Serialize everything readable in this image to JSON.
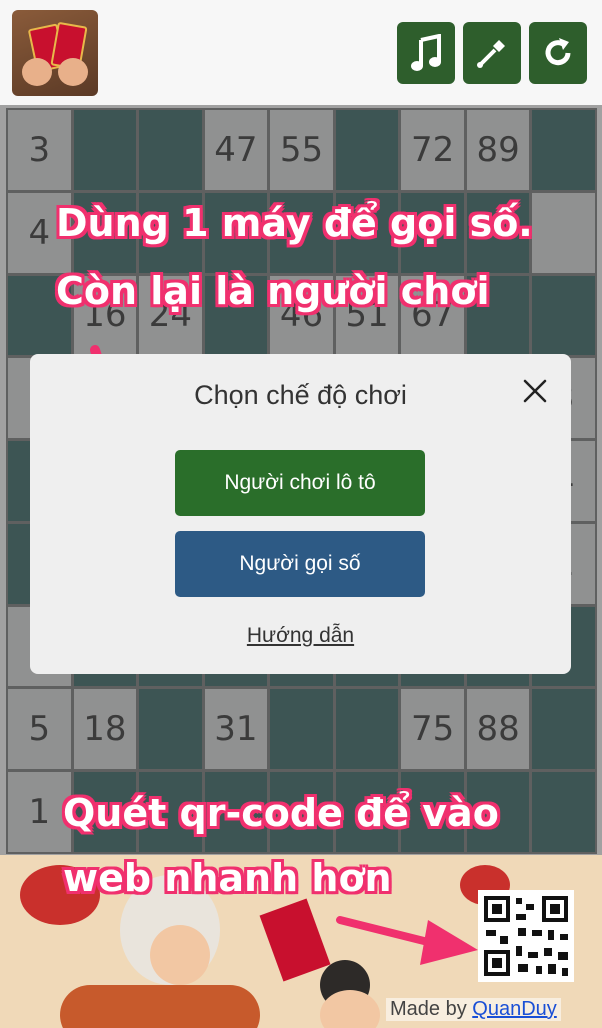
{
  "toolbar": {
    "music_icon": "music-note-icon",
    "picker_icon": "eyedropper-icon",
    "refresh_icon": "refresh-icon",
    "button_color": "#2e5e2c"
  },
  "board": {
    "rows": [
      [
        "3",
        "",
        "",
        "47",
        "55",
        "",
        "72",
        "89"
      ],
      [
        "4",
        "",
        "",
        "",
        "",
        "",
        "",
        "",
        ""
      ],
      [
        "",
        "16",
        "24",
        "",
        "46",
        "51",
        "67",
        "",
        "",
        ""
      ],
      [
        "",
        "",
        "",
        "",
        "",
        "",
        "",
        "",
        "3"
      ],
      [
        "",
        "",
        "",
        "",
        "",
        "",
        "",
        "",
        "4"
      ],
      [
        "",
        "",
        "",
        "",
        "",
        "",
        "",
        "",
        "1"
      ],
      [
        "",
        "",
        "",
        "",
        "",
        "",
        "",
        "",
        ""
      ],
      [
        "5",
        "18",
        "",
        "31",
        "",
        "",
        "75",
        "88"
      ],
      [
        "1",
        "",
        "",
        "",
        "",
        "",
        "",
        ""
      ]
    ],
    "number_color": "#d6d8d8",
    "empty_color": "#3e6a68"
  },
  "callouts": {
    "top_line1": "Dùng 1 máy để gọi số.",
    "top_line2": "Còn lại là người chơi",
    "bottom_line1": "Quét qr-code để vào",
    "bottom_line2": "web nhanh hơn",
    "color": "#f0306e"
  },
  "modal": {
    "title": "Chọn chế độ chơi",
    "player_button": "Người chơi lô tô",
    "caller_button": "Người gọi số",
    "guide_link": "Hướng dẫn",
    "player_color": "#2a6e2a",
    "caller_color": "#2d5a85"
  },
  "footer": {
    "made_by": "Made by ",
    "author": "QuanDuy"
  }
}
